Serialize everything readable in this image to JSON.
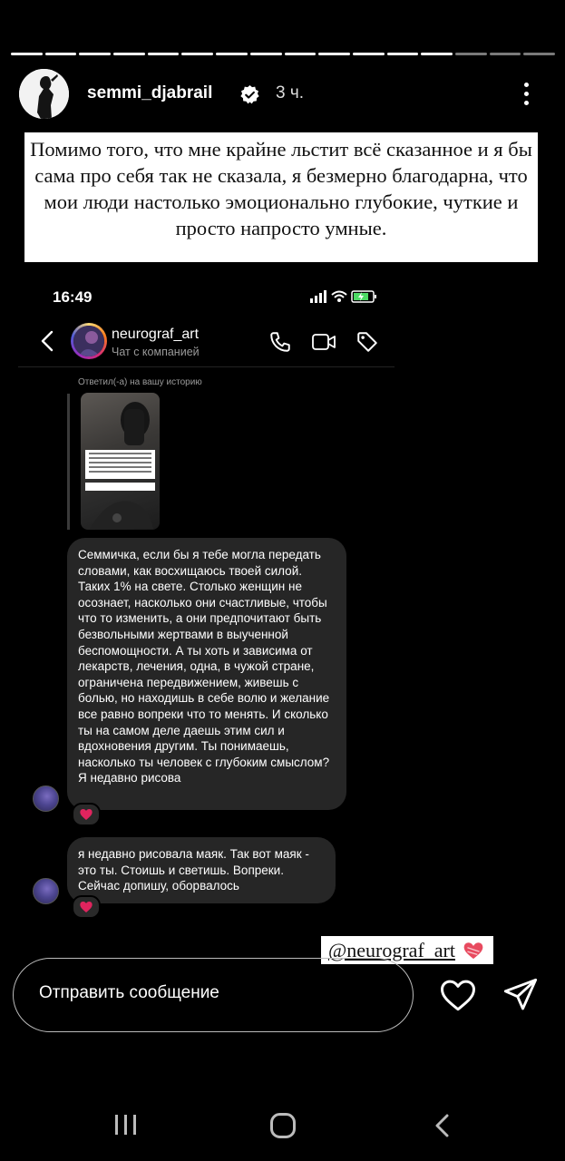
{
  "story": {
    "username": "semmi_djabrail",
    "time": "3 ч.",
    "progress_segments": 16,
    "progress_viewed": 13,
    "caption": "Помимо того, что мне крайне льстит всё сказанное и я бы сама про себя так не сказала, я безмерно благодарна, что мои люди настолько эмоционально глубокие, чуткие и просто напросто умные.",
    "mention": "@neurograf_art",
    "reply_placeholder": "Отправить сообщение"
  },
  "screenshot": {
    "clock": "16:49",
    "chat": {
      "name": "neurograf_art",
      "subtitle": "Чат с компанией"
    },
    "replied_label": "Ответил(-а) на вашу историю",
    "messages": [
      {
        "text": "Семмичка, если бы я тебе могла передать словами, как восхищаюсь твоей силой. Таких 1% на свете. Столько женщин не осознает, насколько они счастливые, чтобы что то изменить, а они предпочитают быть безвольными жертвами в выученной беспомощности. А ты хоть и зависима от лекарств, лечения, одна, в чужой стране, ограничена передвижением, живешь с болью, но находишь в себе волю и желание все равно вопреки что то менять. И сколько ты на самом деле даешь этим сил и вдохновения другим. Ты понимаешь, насколько ты человек с глубоким смыслом? Я недавно рисова",
        "reaction": "❤"
      },
      {
        "text": "я недавно рисовала маяк. Так вот маяк - это ты. Стоишь и светишь. Вопреки. Сейчас допишу, оборвалось",
        "reaction": "❤"
      }
    ]
  },
  "colors": {
    "background": "#000000",
    "bubble": "#262626",
    "heart": "#e0245e",
    "muted": "#9a9a9a"
  }
}
